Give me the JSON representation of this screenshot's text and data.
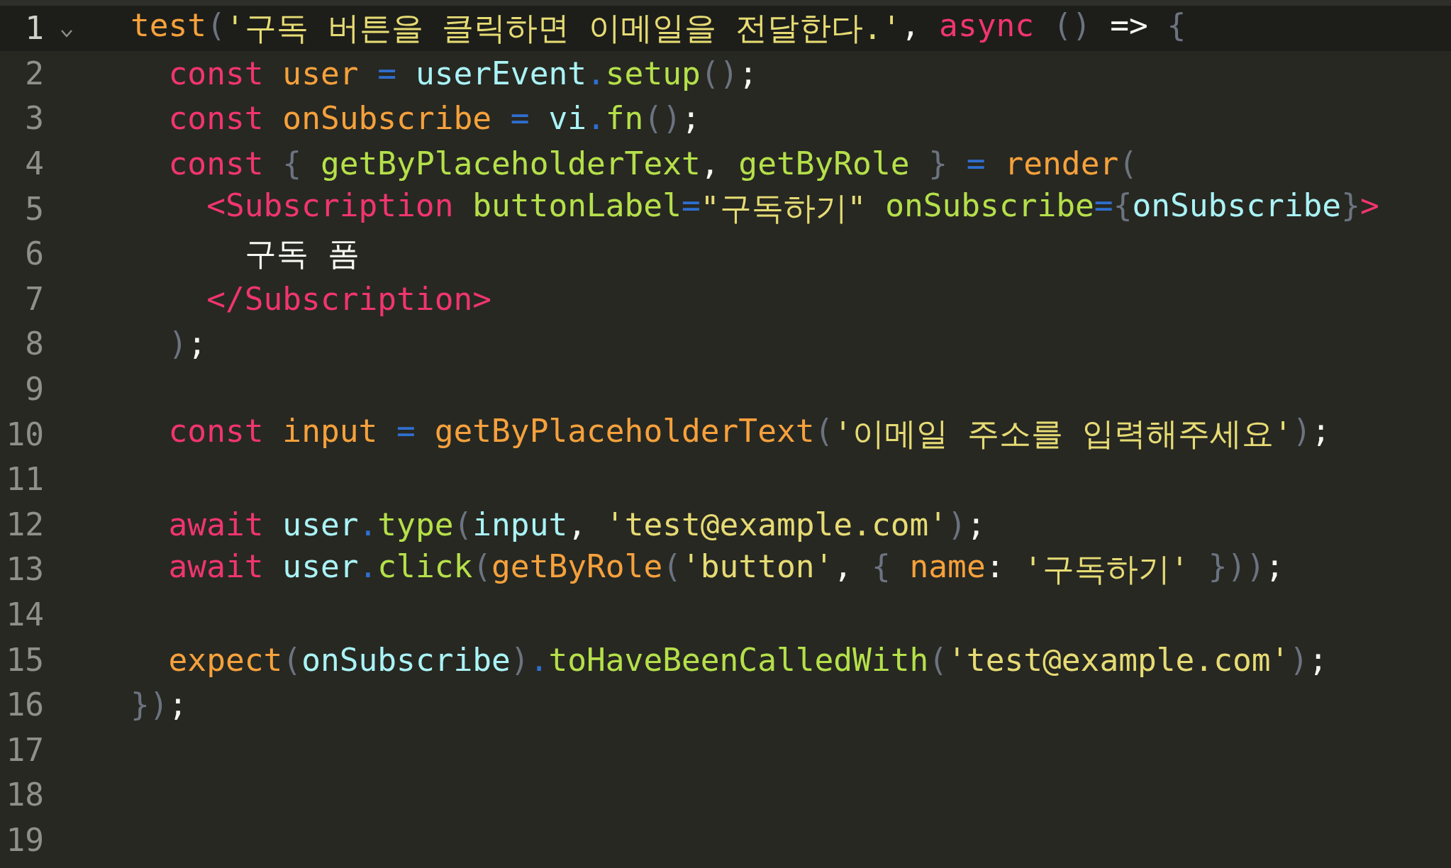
{
  "editor": {
    "lines": [
      {
        "number": "1",
        "selected": true,
        "fold": {
          "expanded": true
        },
        "tokens": [
          {
            "kind": "param",
            "text": "test"
          },
          {
            "kind": "punc",
            "text": "("
          },
          {
            "kind": "str",
            "text": "'구독 버튼을 클릭하면 이메일을 전달한다.'"
          },
          {
            "kind": "plain",
            "text": ", "
          },
          {
            "kind": "kw",
            "text": "async"
          },
          {
            "kind": "punc",
            "text": " ()"
          },
          {
            "kind": "plain",
            "text": " =>"
          },
          {
            "kind": "punc",
            "text": " {"
          }
        ]
      },
      {
        "number": "2",
        "selected": false,
        "tokens": [
          {
            "kind": "kw",
            "text": "  const"
          },
          {
            "kind": "param",
            "text": " user"
          },
          {
            "kind": "op",
            "text": " ="
          },
          {
            "kind": "var",
            "text": " userEvent"
          },
          {
            "kind": "op",
            "text": "."
          },
          {
            "kind": "fn",
            "text": "setup"
          },
          {
            "kind": "punc",
            "text": "()"
          },
          {
            "kind": "plain",
            "text": ";"
          }
        ]
      },
      {
        "number": "3",
        "selected": false,
        "tokens": [
          {
            "kind": "kw",
            "text": "  const"
          },
          {
            "kind": "param",
            "text": " onSubscribe"
          },
          {
            "kind": "op",
            "text": " ="
          },
          {
            "kind": "var",
            "text": " vi"
          },
          {
            "kind": "op",
            "text": "."
          },
          {
            "kind": "fn",
            "text": "fn"
          },
          {
            "kind": "punc",
            "text": "()"
          },
          {
            "kind": "plain",
            "text": ";"
          }
        ]
      },
      {
        "number": "4",
        "selected": false,
        "tokens": [
          {
            "kind": "kw",
            "text": "  const"
          },
          {
            "kind": "punc",
            "text": " {"
          },
          {
            "kind": "fn",
            "text": " getByPlaceholderText"
          },
          {
            "kind": "plain",
            "text": ","
          },
          {
            "kind": "fn",
            "text": " getByRole"
          },
          {
            "kind": "punc",
            "text": " }"
          },
          {
            "kind": "op",
            "text": " ="
          },
          {
            "kind": "param",
            "text": " render"
          },
          {
            "kind": "punc",
            "text": "("
          }
        ]
      },
      {
        "number": "5",
        "selected": false,
        "tokens": [
          {
            "kind": "kw",
            "text": "    <Subscription"
          },
          {
            "kind": "fn",
            "text": " buttonLabel"
          },
          {
            "kind": "op",
            "text": "="
          },
          {
            "kind": "str",
            "text": "\"구독하기\""
          },
          {
            "kind": "fn",
            "text": " onSubscribe"
          },
          {
            "kind": "op",
            "text": "="
          },
          {
            "kind": "punc",
            "text": "{"
          },
          {
            "kind": "var",
            "text": "onSubscribe"
          },
          {
            "kind": "punc",
            "text": "}"
          },
          {
            "kind": "kw",
            "text": ">"
          }
        ]
      },
      {
        "number": "6",
        "selected": false,
        "tokens": [
          {
            "kind": "plain",
            "text": "      구독 폼"
          }
        ]
      },
      {
        "number": "7",
        "selected": false,
        "tokens": [
          {
            "kind": "kw",
            "text": "    </Subscription>"
          }
        ]
      },
      {
        "number": "8",
        "selected": false,
        "tokens": [
          {
            "kind": "punc",
            "text": "  )"
          },
          {
            "kind": "plain",
            "text": ";"
          }
        ]
      },
      {
        "number": "9",
        "selected": false
      },
      {
        "number": "10",
        "selected": false,
        "tokens": [
          {
            "kind": "kw",
            "text": "  const"
          },
          {
            "kind": "param",
            "text": " input"
          },
          {
            "kind": "op",
            "text": " ="
          },
          {
            "kind": "param",
            "text": " getByPlaceholderText"
          },
          {
            "kind": "punc",
            "text": "("
          },
          {
            "kind": "str",
            "text": "'이메일 주소를 입력해주세요'"
          },
          {
            "kind": "punc",
            "text": ")"
          },
          {
            "kind": "plain",
            "text": ";"
          }
        ]
      },
      {
        "number": "11",
        "selected": false
      },
      {
        "number": "12",
        "selected": false,
        "tokens": [
          {
            "kind": "kw",
            "text": "  await"
          },
          {
            "kind": "var",
            "text": " user"
          },
          {
            "kind": "op",
            "text": "."
          },
          {
            "kind": "fn",
            "text": "type"
          },
          {
            "kind": "punc",
            "text": "("
          },
          {
            "kind": "var",
            "text": "input"
          },
          {
            "kind": "plain",
            "text": ","
          },
          {
            "kind": "str",
            "text": " 'test@example.com'"
          },
          {
            "kind": "punc",
            "text": ")"
          },
          {
            "kind": "plain",
            "text": ";"
          }
        ]
      },
      {
        "number": "13",
        "selected": false,
        "tokens": [
          {
            "kind": "kw",
            "text": "  await"
          },
          {
            "kind": "var",
            "text": " user"
          },
          {
            "kind": "op",
            "text": "."
          },
          {
            "kind": "fn",
            "text": "click"
          },
          {
            "kind": "punc",
            "text": "("
          },
          {
            "kind": "param",
            "text": "getByRole"
          },
          {
            "kind": "punc",
            "text": "("
          },
          {
            "kind": "str",
            "text": "'button'"
          },
          {
            "kind": "plain",
            "text": ","
          },
          {
            "kind": "punc",
            "text": " {"
          },
          {
            "kind": "param",
            "text": " name"
          },
          {
            "kind": "plain",
            "text": ":"
          },
          {
            "kind": "str",
            "text": " '구독하기'"
          },
          {
            "kind": "punc",
            "text": " }))"
          },
          {
            "kind": "plain",
            "text": ";"
          }
        ]
      },
      {
        "number": "14",
        "selected": false
      },
      {
        "number": "15",
        "selected": false,
        "tokens": [
          {
            "kind": "param",
            "text": "  expect"
          },
          {
            "kind": "punc",
            "text": "("
          },
          {
            "kind": "var",
            "text": "onSubscribe"
          },
          {
            "kind": "punc",
            "text": ")"
          },
          {
            "kind": "op",
            "text": "."
          },
          {
            "kind": "fn",
            "text": "toHaveBeenCalledWith"
          },
          {
            "kind": "punc",
            "text": "("
          },
          {
            "kind": "str",
            "text": "'test@example.com'"
          },
          {
            "kind": "punc",
            "text": ")"
          },
          {
            "kind": "plain",
            "text": ";"
          }
        ]
      },
      {
        "number": "16",
        "selected": false,
        "tokens": [
          {
            "kind": "punc",
            "text": "})"
          },
          {
            "kind": "plain",
            "text": ";"
          }
        ]
      },
      {
        "number": "17",
        "selected": false
      },
      {
        "number": "18",
        "selected": false
      },
      {
        "number": "19",
        "selected": false
      }
    ]
  }
}
